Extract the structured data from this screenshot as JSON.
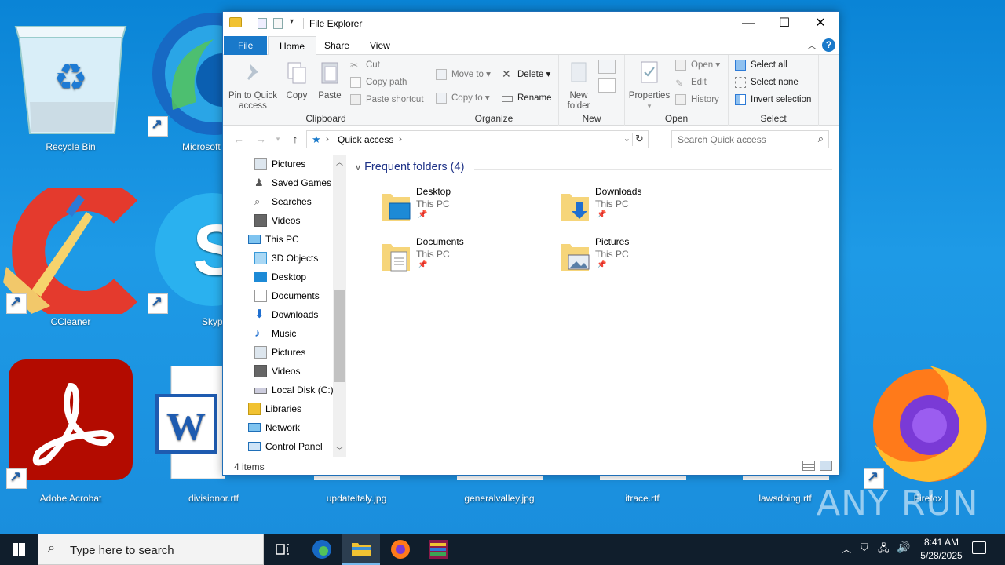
{
  "desktop": {
    "icons": [
      {
        "label": "Recycle Bin"
      },
      {
        "label": "Microsoft"
      },
      {
        "label": "CCleaner"
      },
      {
        "label": "Skyp"
      },
      {
        "label": "Adobe Acrobat"
      },
      {
        "label": "divisionor.rtf"
      },
      {
        "label": "updateitaly.jpg"
      },
      {
        "label": "generalvalley.jpg"
      },
      {
        "label": "itrace.rtf"
      },
      {
        "label": "lawsdoing.rtf"
      },
      {
        "label": "Firefox"
      }
    ],
    "watermark": "ANY RUN"
  },
  "explorer": {
    "title": "File Explorer",
    "controls": {
      "minimize": "—",
      "maximize": "☐",
      "close": "✕"
    },
    "tabs": [
      {
        "label": "File"
      },
      {
        "label": "Home"
      },
      {
        "label": "Share"
      },
      {
        "label": "View"
      }
    ],
    "help": "?",
    "ribbon": {
      "clipboard": {
        "label": "Clipboard",
        "pin_line1": "Pin to Quick",
        "pin_line2": "access",
        "copy": "Copy",
        "paste": "Paste",
        "cut": "Cut",
        "copy_path": "Copy path",
        "paste_shortcut": "Paste shortcut"
      },
      "organize": {
        "label": "Organize",
        "move_to": "Move to",
        "copy_to": "Copy to",
        "delete": "Delete",
        "rename": "Rename"
      },
      "new": {
        "label": "New",
        "new_folder_line1": "New",
        "new_folder_line2": "folder"
      },
      "open": {
        "label": "Open",
        "properties": "Properties",
        "open": "Open",
        "edit": "Edit",
        "history": "History"
      },
      "select": {
        "label": "Select",
        "select_all": "Select all",
        "select_none": "Select none",
        "invert_selection": "Invert selection"
      }
    },
    "address": {
      "crumb": "Quick access",
      "search_placeholder": "Search Quick access"
    },
    "nav_items": [
      {
        "label": "Pictures",
        "icon": "pictures-icon"
      },
      {
        "label": "Saved Games",
        "icon": "saved-games-icon"
      },
      {
        "label": "Searches",
        "icon": "searches-icon"
      },
      {
        "label": "Videos",
        "icon": "videos-icon"
      },
      {
        "label": "This PC",
        "icon": "this-pc-icon"
      },
      {
        "label": "3D Objects",
        "icon": "3d-objects-icon"
      },
      {
        "label": "Desktop",
        "icon": "desktop-icon"
      },
      {
        "label": "Documents",
        "icon": "documents-icon"
      },
      {
        "label": "Downloads",
        "icon": "downloads-icon"
      },
      {
        "label": "Music",
        "icon": "music-icon"
      },
      {
        "label": "Pictures",
        "icon": "pictures-icon"
      },
      {
        "label": "Videos",
        "icon": "videos-icon"
      },
      {
        "label": "Local Disk (C:)",
        "icon": "local-disk-icon"
      },
      {
        "label": "Libraries",
        "icon": "libraries-icon"
      },
      {
        "label": "Network",
        "icon": "network-icon"
      },
      {
        "label": "Control Panel",
        "icon": "control-panel-icon"
      }
    ],
    "section_title": "Frequent folders (4)",
    "folders": [
      {
        "name": "Desktop",
        "location": "This PC"
      },
      {
        "name": "Downloads",
        "location": "This PC"
      },
      {
        "name": "Documents",
        "location": "This PC"
      },
      {
        "name": "Pictures",
        "location": "This PC"
      }
    ],
    "status": "4 items"
  },
  "taskbar": {
    "search_placeholder": "Type here to search",
    "time": "8:41 AM",
    "date": "5/28/2025"
  },
  "colors": {
    "accent": "#1979ca",
    "desktop_bg": "#1a8ddc",
    "taskbar_bg": "#101e2c"
  }
}
